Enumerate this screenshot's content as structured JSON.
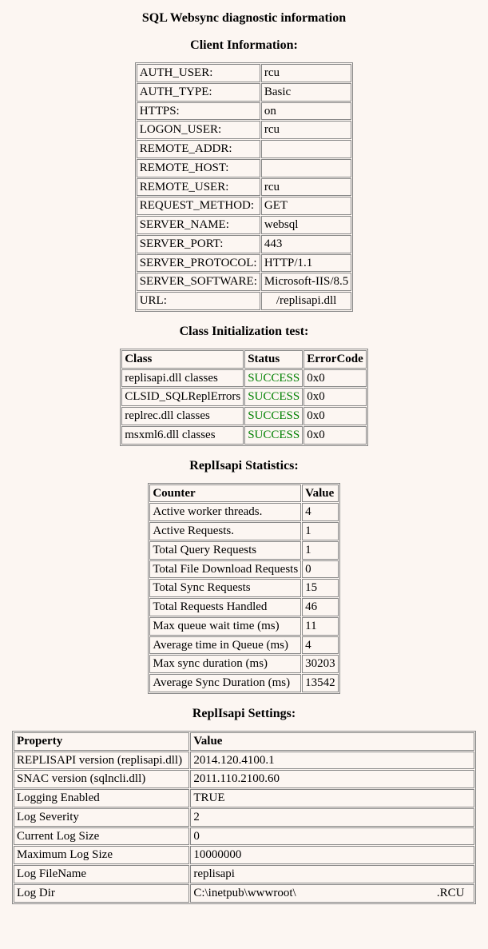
{
  "title": "SQL Websync diagnostic information",
  "client_info": {
    "heading": "Client Information:",
    "rows": [
      {
        "label": "AUTH_USER:",
        "value": "rcu"
      },
      {
        "label": "AUTH_TYPE:",
        "value": "Basic"
      },
      {
        "label": "HTTPS:",
        "value": "on"
      },
      {
        "label": "LOGON_USER:",
        "value": "rcu"
      },
      {
        "label": "REMOTE_ADDR:",
        "value": ""
      },
      {
        "label": "REMOTE_HOST:",
        "value": ""
      },
      {
        "label": "REMOTE_USER:",
        "value": "rcu"
      },
      {
        "label": "REQUEST_METHOD:",
        "value": "GET"
      },
      {
        "label": "SERVER_NAME:",
        "value": "websql"
      },
      {
        "label": "SERVER_PORT:",
        "value": "443"
      },
      {
        "label": "SERVER_PROTOCOL:",
        "value": "HTTP/1.1"
      },
      {
        "label": "SERVER_SOFTWARE:",
        "value": "Microsoft-IIS/8.5"
      },
      {
        "label": "URL:",
        "value": "/replisapi.dll",
        "align": "center"
      }
    ]
  },
  "class_init": {
    "heading": "Class Initialization test:",
    "headers": [
      "Class",
      "Status",
      "ErrorCode"
    ],
    "rows": [
      {
        "cls": "replisapi.dll classes",
        "status": "SUCCESS",
        "err": "0x0"
      },
      {
        "cls": "CLSID_SQLReplErrors",
        "status": "SUCCESS",
        "err": "0x0"
      },
      {
        "cls": "replrec.dll classes",
        "status": "SUCCESS",
        "err": "0x0"
      },
      {
        "cls": "msxml6.dll classes",
        "status": "SUCCESS",
        "err": "0x0"
      }
    ]
  },
  "stats": {
    "heading": "ReplIsapi Statistics:",
    "headers": [
      "Counter",
      "Value"
    ],
    "rows": [
      {
        "counter": "Active worker threads.",
        "value": "4"
      },
      {
        "counter": "Active Requests.",
        "value": "1"
      },
      {
        "counter": "Total Query Requests",
        "value": "1"
      },
      {
        "counter": "Total File Download Requests",
        "value": "0"
      },
      {
        "counter": "Total Sync Requests",
        "value": "15"
      },
      {
        "counter": "Total Requests Handled",
        "value": "46"
      },
      {
        "counter": "Max queue wait time (ms)",
        "value": "11"
      },
      {
        "counter": "Average time in Queue (ms)",
        "value": "4"
      },
      {
        "counter": "Max sync duration (ms)",
        "value": "30203"
      },
      {
        "counter": "Average Sync Duration (ms)",
        "value": "13542"
      }
    ]
  },
  "settings": {
    "heading": "ReplIsapi Settings:",
    "headers": [
      "Property",
      "Value"
    ],
    "rows": [
      {
        "prop": "REPLISAPI version (replisapi.dll)",
        "value": "2014.120.4100.1"
      },
      {
        "prop": "SNAC version (sqlncli.dll)",
        "value": "2011.110.2100.60"
      },
      {
        "prop": "Logging Enabled",
        "value": "TRUE"
      },
      {
        "prop": "Log Severity",
        "value": "2"
      },
      {
        "prop": "Current Log Size",
        "value": "0"
      },
      {
        "prop": "Maximum Log Size",
        "value": "10000000"
      },
      {
        "prop": "Log FileName",
        "value": "replisapi"
      },
      {
        "prop": "Log Dir",
        "value": "C:\\inetpub\\wwwroot\\                                               .RCU",
        "align": ""
      }
    ]
  }
}
